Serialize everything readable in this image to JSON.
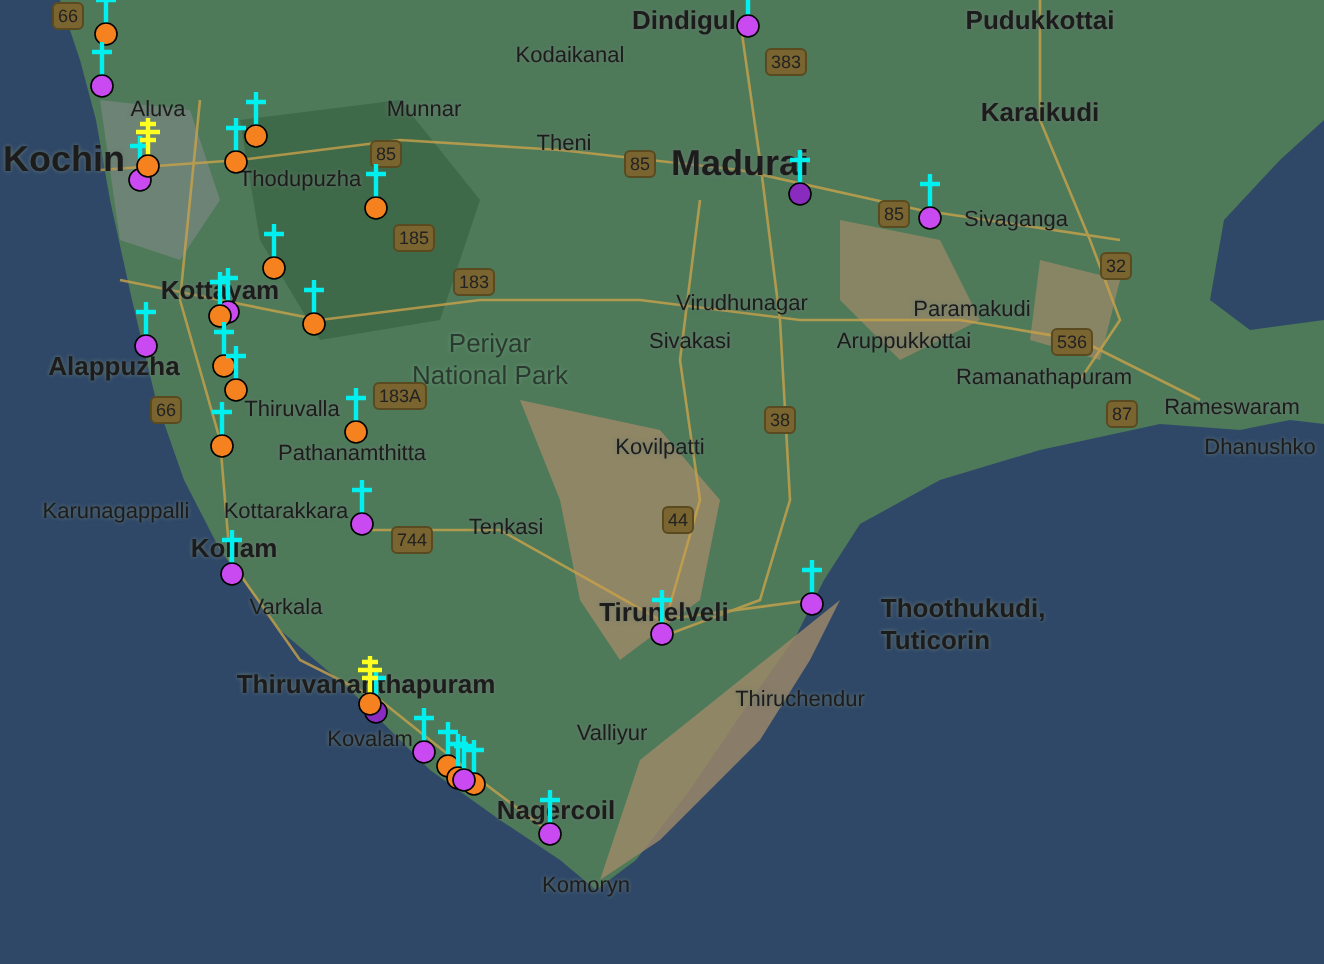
{
  "map": {
    "labels": [
      {
        "text": "Kodaikanal",
        "kind": "town"
      },
      {
        "text": "Dindigul",
        "kind": "city"
      },
      {
        "text": "Pudukkottai",
        "kind": "city"
      },
      {
        "text": "Aluva",
        "kind": "town"
      },
      {
        "text": "Munnar",
        "kind": "town"
      },
      {
        "text": "Theni",
        "kind": "town"
      },
      {
        "text": "Kochin",
        "kind": "major"
      },
      {
        "text": "Thodupuzha",
        "kind": "town"
      },
      {
        "text": "Madurai",
        "kind": "major"
      },
      {
        "text": "Karaikudi",
        "kind": "city"
      },
      {
        "text": "Sivaganga",
        "kind": "town"
      },
      {
        "text": "Kottayam",
        "kind": "city"
      },
      {
        "text": "Periyar National Park",
        "kind": "park"
      },
      {
        "text": "Virudhunagar",
        "kind": "town"
      },
      {
        "text": "Paramakudi",
        "kind": "town"
      },
      {
        "text": "Sivakasi",
        "kind": "town"
      },
      {
        "text": "Aruppukkottai",
        "kind": "town"
      },
      {
        "text": "Alappuzha",
        "kind": "city"
      },
      {
        "text": "Ramanathapuram",
        "kind": "town"
      },
      {
        "text": "Thiruvalla",
        "kind": "town"
      },
      {
        "text": "Rameswaram",
        "kind": "town"
      },
      {
        "text": "Pathanamthitta",
        "kind": "town"
      },
      {
        "text": "Kovilpatti",
        "kind": "town"
      },
      {
        "text": "Dhanushko",
        "kind": "town"
      },
      {
        "text": "Karunagappalli",
        "kind": "town"
      },
      {
        "text": "Kottarakkara",
        "kind": "town"
      },
      {
        "text": "Tenkasi",
        "kind": "town"
      },
      {
        "text": "Kollam",
        "kind": "city"
      },
      {
        "text": "Varkala",
        "kind": "town"
      },
      {
        "text": "Tirunelveli",
        "kind": "city"
      },
      {
        "text": "Thoothukudi, Tuticorin",
        "kind": "city"
      },
      {
        "text": "Thiruvananthapuram",
        "kind": "city"
      },
      {
        "text": "Thiruchendur",
        "kind": "town"
      },
      {
        "text": "Kovalam",
        "kind": "town"
      },
      {
        "text": "Valliyur",
        "kind": "town"
      },
      {
        "text": "Nagercoil",
        "kind": "city"
      },
      {
        "text": "Komoryn",
        "kind": "town"
      }
    ],
    "shields": [
      "66",
      "383",
      "85",
      "85",
      "85",
      "185",
      "183",
      "32",
      "536",
      "183A",
      "66",
      "87",
      "38",
      "44",
      "744"
    ],
    "markers": [
      {
        "color": "#f5821f",
        "kind": "cross"
      },
      {
        "color": "#c84af0",
        "kind": "cross"
      },
      {
        "color": "#c84af0",
        "kind": "cross"
      },
      {
        "color": "#f5821f",
        "kind": "double"
      },
      {
        "color": "#f5821f",
        "kind": "cross"
      },
      {
        "color": "#f5821f",
        "kind": "cross"
      },
      {
        "color": "#f5821f",
        "kind": "cross"
      },
      {
        "color": "#f5821f",
        "kind": "cross"
      },
      {
        "color": "#f5821f",
        "kind": "cross"
      },
      {
        "color": "#c84af0",
        "kind": "cross"
      },
      {
        "color": "#f5821f",
        "kind": "cross"
      },
      {
        "color": "#c84af0",
        "kind": "cross"
      },
      {
        "color": "#f5821f",
        "kind": "cross"
      },
      {
        "color": "#f5821f",
        "kind": "cross"
      },
      {
        "color": "#f5821f",
        "kind": "cross"
      },
      {
        "color": "#f5821f",
        "kind": "cross"
      },
      {
        "color": "#c84af0",
        "kind": "cross"
      },
      {
        "color": "#8a2bc0",
        "kind": "cross"
      },
      {
        "color": "#c84af0",
        "kind": "cross"
      },
      {
        "color": "#c84af0",
        "kind": "cross"
      },
      {
        "color": "#c84af0",
        "kind": "cross"
      },
      {
        "color": "#8a2bc0",
        "kind": "cross"
      },
      {
        "color": "#f5821f",
        "kind": "double"
      },
      {
        "color": "#c84af0",
        "kind": "cross"
      },
      {
        "color": "#f5821f",
        "kind": "cross"
      },
      {
        "color": "#f5821f",
        "kind": "cross"
      },
      {
        "color": "#f5821f",
        "kind": "cross"
      },
      {
        "color": "#c84af0",
        "kind": "cross"
      },
      {
        "color": "#c84af0",
        "kind": "cross"
      },
      {
        "color": "#c84af0",
        "kind": "cross"
      },
      {
        "color": "#c84af0",
        "kind": "cross"
      }
    ]
  }
}
